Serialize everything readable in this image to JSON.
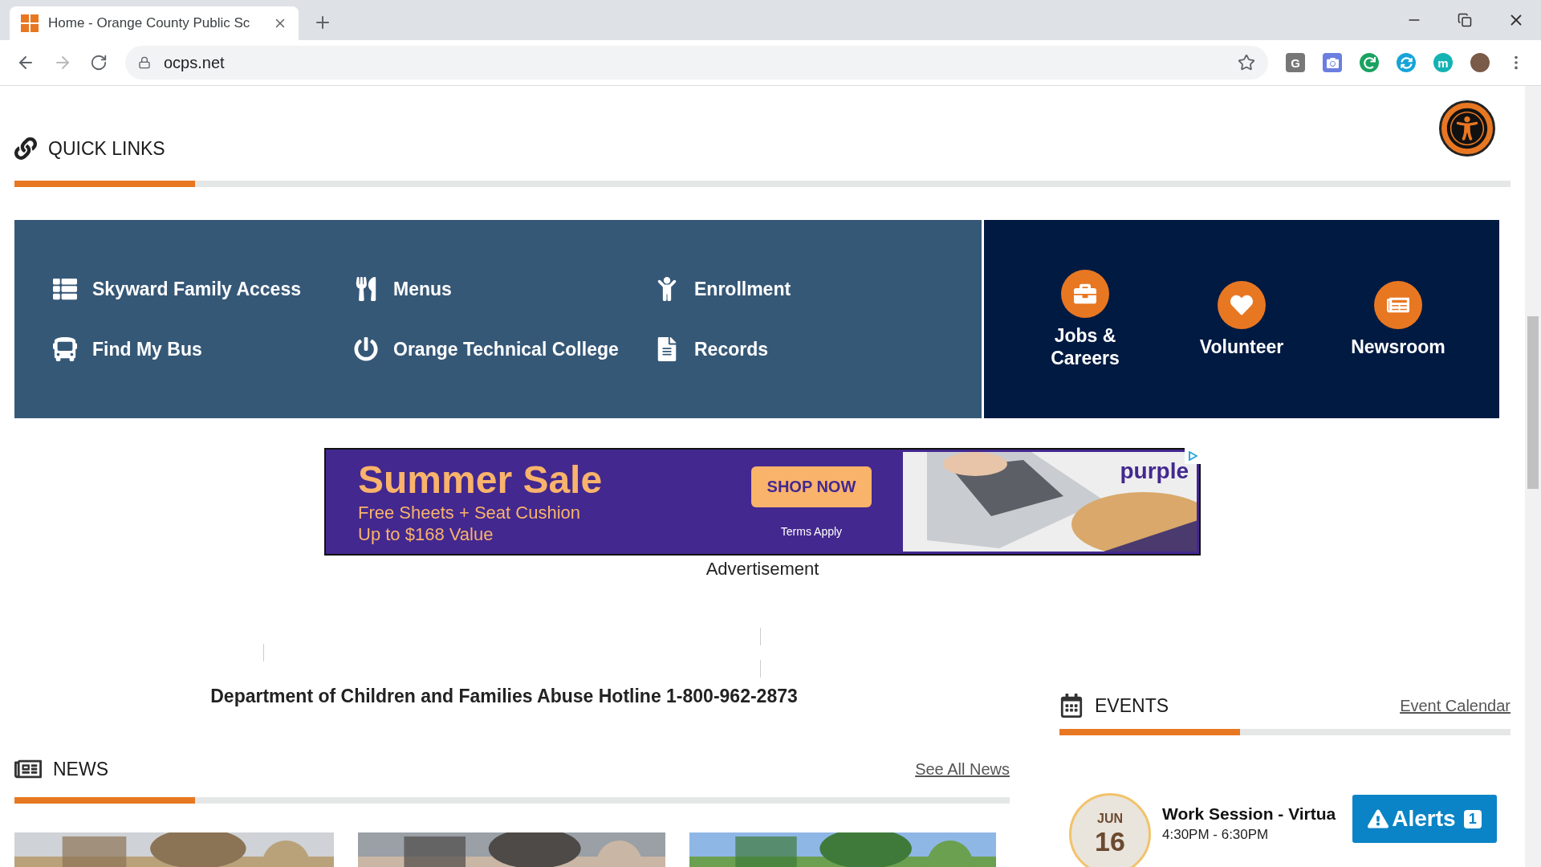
{
  "browser": {
    "tab_title": "Home - Orange County Public Sc",
    "url": "ocps.net",
    "extensions": [
      {
        "kind": "letter",
        "label": "G"
      },
      {
        "kind": "camera"
      },
      {
        "kind": "refresh"
      },
      {
        "kind": "sync"
      },
      {
        "kind": "letter",
        "label": "m"
      },
      {
        "kind": "avatar"
      }
    ]
  },
  "quick_links": {
    "title": "QUICK LINKS",
    "links": [
      {
        "label": "Skyward Family Access",
        "kind": "list"
      },
      {
        "label": "Menus",
        "kind": "utensils"
      },
      {
        "label": "Enrollment",
        "kind": "child"
      },
      {
        "label": "Find My Bus",
        "kind": "bus"
      },
      {
        "label": "Orange Technical College",
        "kind": "power"
      },
      {
        "label": "Records",
        "kind": "file"
      }
    ],
    "featured": [
      {
        "label": "Jobs & Careers",
        "kind": "briefcase"
      },
      {
        "label": "Volunteer",
        "kind": "heart"
      },
      {
        "label": "Newsroom",
        "kind": "newspaper"
      }
    ]
  },
  "ad": {
    "headline": "Summer Sale",
    "lines": [
      "Free Sheets + Seat Cushion",
      "Up to $168 Value"
    ],
    "button": "SHOP NOW",
    "terms": "Terms Apply",
    "brand": "purple",
    "caption": "Advertisement"
  },
  "hotline": "Department of Children and Families Abuse Hotline 1-800-962-2873",
  "news": {
    "title": "NEWS",
    "link": "See All News"
  },
  "events": {
    "title": "EVENTS",
    "link": "Event Calendar",
    "items": [
      {
        "month": "JUN",
        "day": "16",
        "title": "Work Session - Virtua",
        "time": "4:30PM - 6:30PM"
      }
    ]
  },
  "alerts": {
    "label": "Alerts",
    "count": "1"
  }
}
